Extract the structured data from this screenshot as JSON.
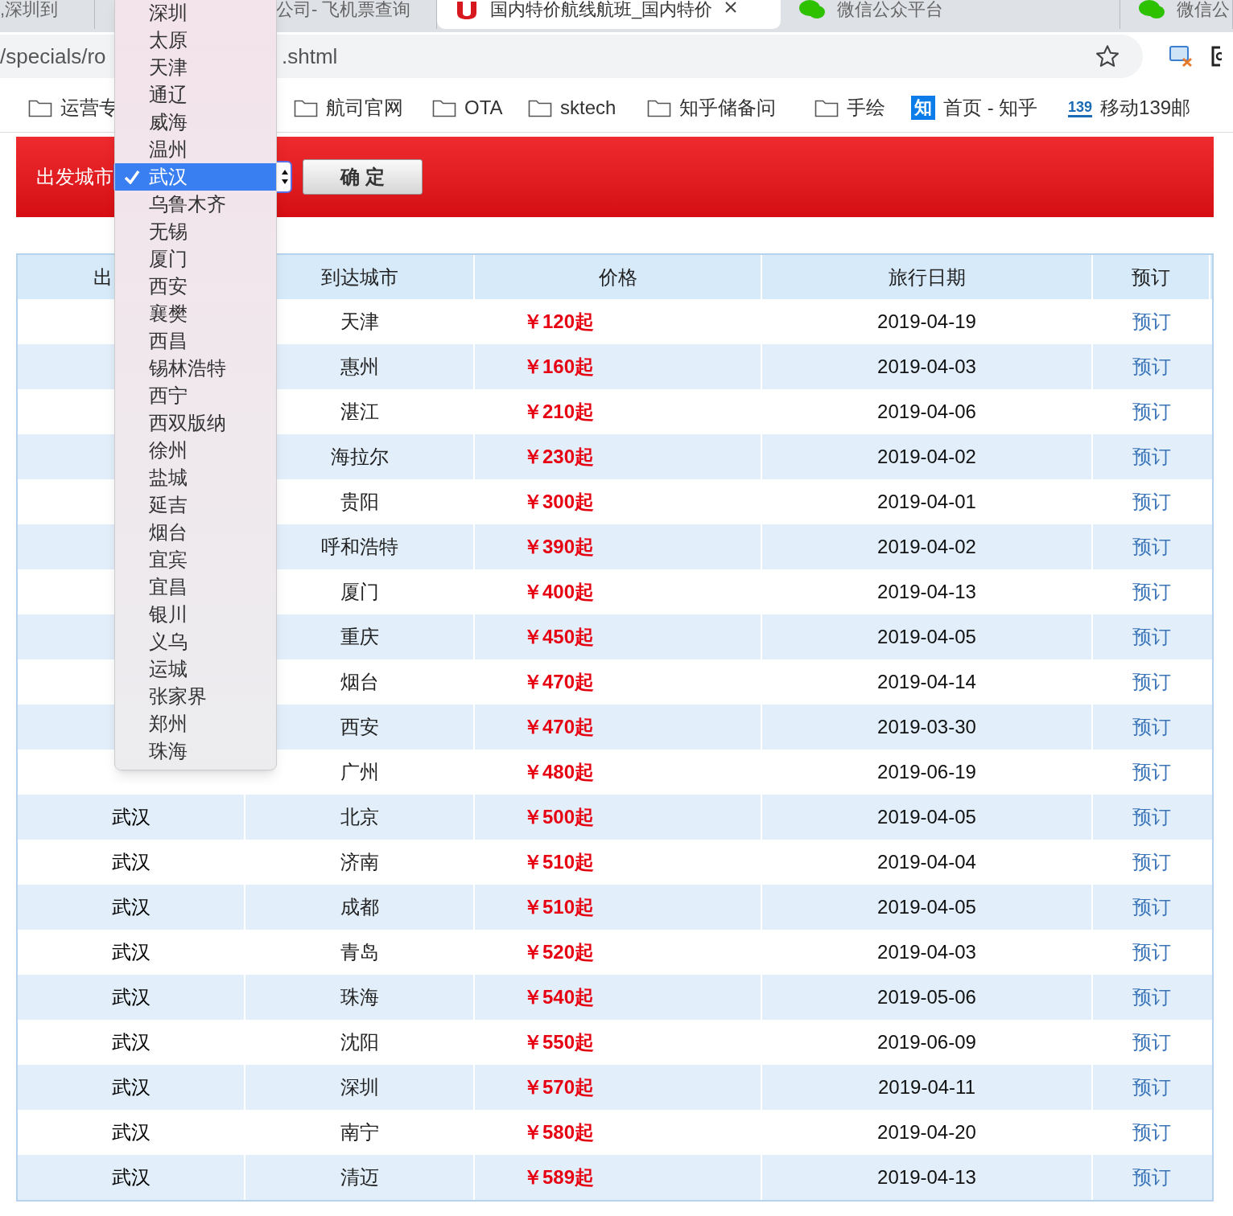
{
  "browser": {
    "tabs": [
      {
        "title": ",深圳到",
        "selected": false,
        "kind": "plain"
      },
      {
        "title": "公司- 飞机票查询",
        "selected": false,
        "kind": "plain"
      },
      {
        "title": "国内特价航线航班_国内特价",
        "selected": true,
        "kind": "airline"
      },
      {
        "title": "微信公众平台",
        "selected": false,
        "kind": "chat"
      },
      {
        "title": "微信公",
        "selected": false,
        "kind": "chat"
      }
    ],
    "address": {
      "parts": [
        "/specials/ro",
        ".shtml"
      ]
    },
    "bookmarks": [
      {
        "label": "运营专",
        "kind": "folder"
      },
      {
        "label": "航司官网",
        "kind": "folder"
      },
      {
        "label": "OTA",
        "kind": "folder"
      },
      {
        "label": "sktech",
        "kind": "folder"
      },
      {
        "label": "知乎储备问",
        "kind": "folder"
      },
      {
        "label": "手绘",
        "kind": "folder"
      },
      {
        "label": "首页 - 知乎",
        "kind": "badge",
        "badge": "知"
      },
      {
        "label": "移动139邮",
        "kind": "mail",
        "badge": "139"
      }
    ]
  },
  "search_bar": {
    "label": "出发城市",
    "button": "确 定"
  },
  "city_dropdown": {
    "items": [
      {
        "label": "深圳",
        "selected": false
      },
      {
        "label": "太原",
        "selected": false
      },
      {
        "label": "天津",
        "selected": false
      },
      {
        "label": "通辽",
        "selected": false
      },
      {
        "label": "威海",
        "selected": false
      },
      {
        "label": "温州",
        "selected": false
      },
      {
        "label": "武汉",
        "selected": true
      },
      {
        "label": "乌鲁木齐",
        "selected": false
      },
      {
        "label": "无锡",
        "selected": false
      },
      {
        "label": "厦门",
        "selected": false
      },
      {
        "label": "西安",
        "selected": false
      },
      {
        "label": "襄樊",
        "selected": false
      },
      {
        "label": "西昌",
        "selected": false
      },
      {
        "label": "锡林浩特",
        "selected": false
      },
      {
        "label": "西宁",
        "selected": false
      },
      {
        "label": "西双版纳",
        "selected": false
      },
      {
        "label": "徐州",
        "selected": false
      },
      {
        "label": "盐城",
        "selected": false
      },
      {
        "label": "延吉",
        "selected": false
      },
      {
        "label": "烟台",
        "selected": false
      },
      {
        "label": "宜宾",
        "selected": false
      },
      {
        "label": "宜昌",
        "selected": false
      },
      {
        "label": "银川",
        "selected": false
      },
      {
        "label": "义乌",
        "selected": false
      },
      {
        "label": "运城",
        "selected": false
      },
      {
        "label": "张家界",
        "selected": false
      },
      {
        "label": "郑州",
        "selected": false
      },
      {
        "label": "珠海",
        "selected": false
      }
    ]
  },
  "table": {
    "columns": [
      "出",
      "到达城市",
      "价格",
      "旅行日期",
      "预订"
    ],
    "rows": [
      {
        "to": "天津",
        "price": "￥120起",
        "date": "2019-04-19",
        "action": "预订"
      },
      {
        "to": "惠州",
        "price": "￥160起",
        "date": "2019-04-03",
        "action": "预订"
      },
      {
        "to": "湛江",
        "price": "￥210起",
        "date": "2019-04-06",
        "action": "预订"
      },
      {
        "to": "海拉尔",
        "price": "￥230起",
        "date": "2019-04-02",
        "action": "预订"
      },
      {
        "to": "贵阳",
        "price": "￥300起",
        "date": "2019-04-01",
        "action": "预订"
      },
      {
        "to": "呼和浩特",
        "price": "￥390起",
        "date": "2019-04-02",
        "action": "预订"
      },
      {
        "to": "厦门",
        "price": "￥400起",
        "date": "2019-04-13",
        "action": "预订"
      },
      {
        "to": "重庆",
        "price": "￥450起",
        "date": "2019-04-05",
        "action": "预订"
      },
      {
        "to": "烟台",
        "price": "￥470起",
        "date": "2019-04-14",
        "action": "预订"
      },
      {
        "to": "西安",
        "price": "￥470起",
        "date": "2019-03-30",
        "action": "预订"
      },
      {
        "to": "广州",
        "price": "￥480起",
        "date": "2019-06-19",
        "action": "预订"
      },
      {
        "from": "武汉",
        "to": "北京",
        "price": "￥500起",
        "date": "2019-04-05",
        "action": "预订"
      },
      {
        "from": "武汉",
        "to": "济南",
        "price": "￥510起",
        "date": "2019-04-04",
        "action": "预订"
      },
      {
        "from": "武汉",
        "to": "成都",
        "price": "￥510起",
        "date": "2019-04-05",
        "action": "预订"
      },
      {
        "from": "武汉",
        "to": "青岛",
        "price": "￥520起",
        "date": "2019-04-03",
        "action": "预订"
      },
      {
        "from": "武汉",
        "to": "珠海",
        "price": "￥540起",
        "date": "2019-05-06",
        "action": "预订"
      },
      {
        "from": "武汉",
        "to": "沈阳",
        "price": "￥550起",
        "date": "2019-06-09",
        "action": "预订"
      },
      {
        "from": "武汉",
        "to": "深圳",
        "price": "￥570起",
        "date": "2019-04-11",
        "action": "预订"
      },
      {
        "from": "武汉",
        "to": "南宁",
        "price": "￥580起",
        "date": "2019-04-20",
        "action": "预订"
      },
      {
        "from": "武汉",
        "to": "清迈",
        "price": "￥589起",
        "date": "2019-04-13",
        "action": "预订"
      }
    ]
  }
}
